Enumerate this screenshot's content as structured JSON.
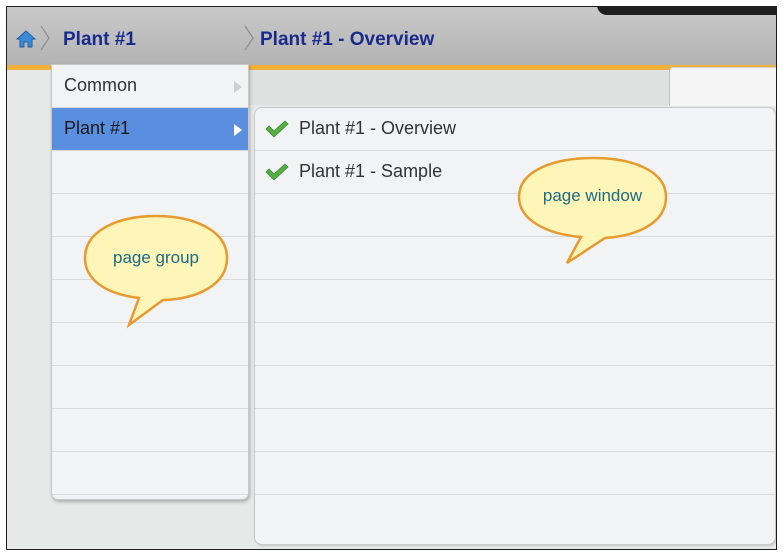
{
  "breadcrumb": {
    "level1": "Plant #1",
    "level2": "Plant #1 - Overview"
  },
  "page_group_menu": {
    "items": [
      {
        "label": "Common"
      },
      {
        "label": "Plant #1"
      }
    ],
    "selected": "Plant #1"
  },
  "page_window_menu": {
    "items": [
      {
        "label": "Plant #1 - Overview"
      },
      {
        "label": "Plant #1 - Sample"
      }
    ]
  },
  "callouts": {
    "group": "page group",
    "window": "page window"
  },
  "colors": {
    "accent": "#f0b03a",
    "selection": "#5a8fe0",
    "breadcrumb_text": "#1a2a8c",
    "check": "#55b043"
  },
  "icons": {
    "home": "home-icon",
    "check": "check-icon",
    "arrow": "chevron-right-icon"
  }
}
